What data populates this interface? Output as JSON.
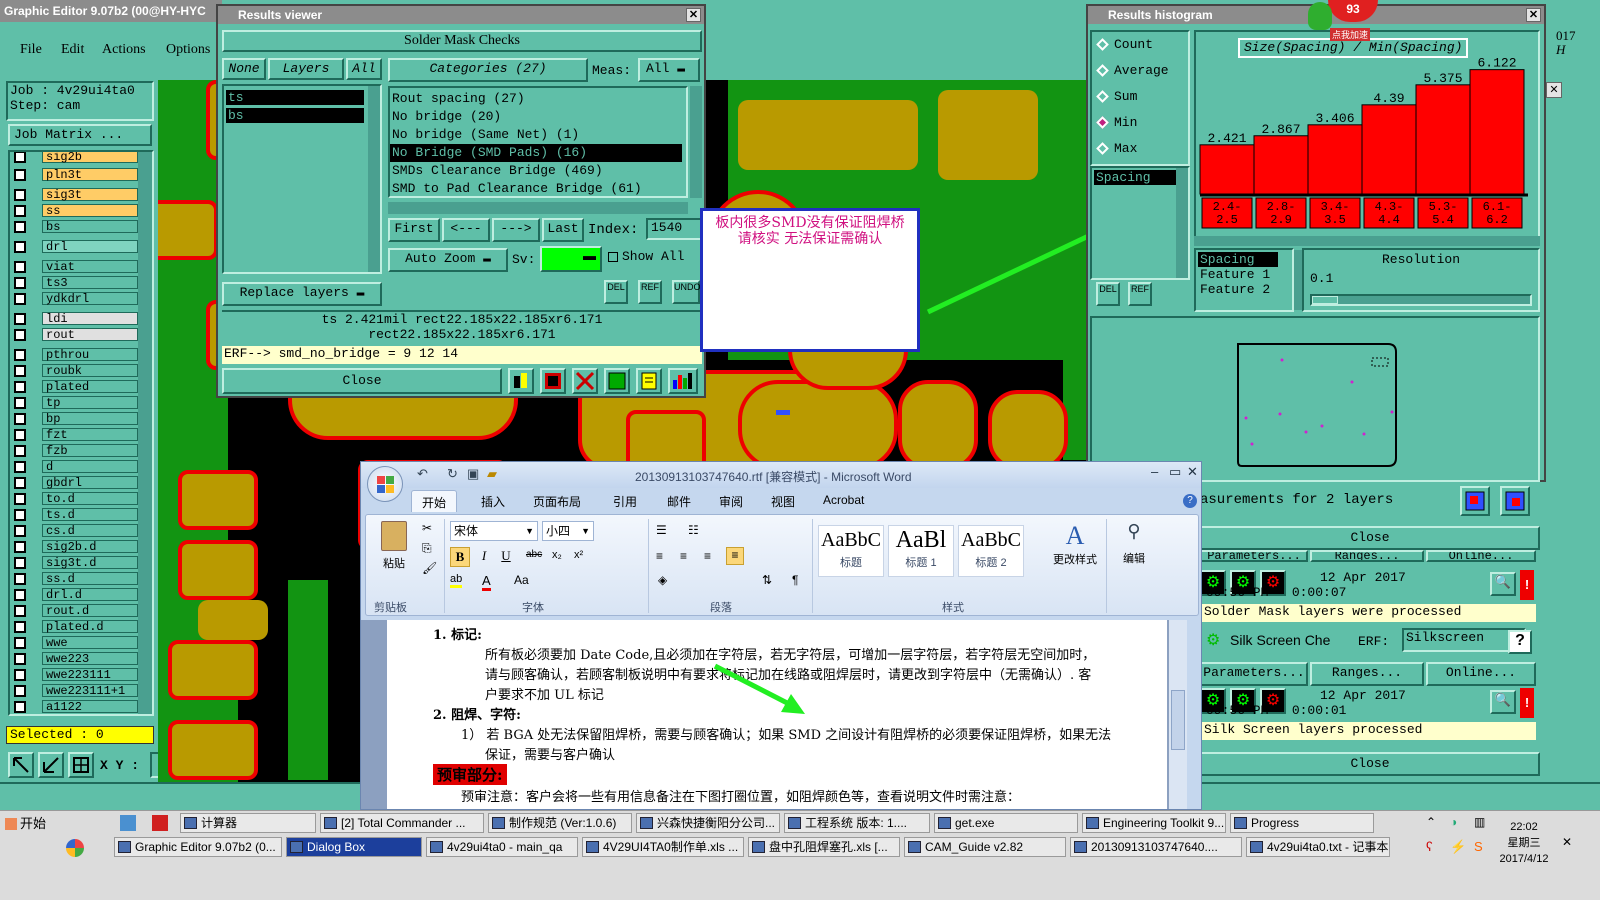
{
  "graphic_editor": {
    "title": "Graphic Editor 9.07b2 (00@HY-HYC",
    "menu": [
      "File",
      "Edit",
      "Actions",
      "Options"
    ],
    "job_label": "Job : 4v29ui4ta0",
    "step_label": "Step: cam",
    "job_matrix_button": "Job Matrix ...",
    "layers": [
      "sig2b",
      "pln3t",
      "sig3t",
      "ss",
      "bs",
      "drl",
      "viat",
      "ts3",
      "ydkdrl",
      "ldi",
      "rout",
      "pthrou",
      "roubk",
      "plated",
      "tp",
      "bp",
      "fzt",
      "fzb",
      "d",
      "gbdrl",
      "to.d",
      "ts.d",
      "cs.d",
      "sig2b.d",
      "sig3t.d",
      "ss.d",
      "drl.d",
      "rout.d",
      "plated.d",
      "wwe",
      "wwe223",
      "wwe223111",
      "wwe223111+1",
      "a1122"
    ],
    "selected_label": "Selected : 0",
    "xy_label": "X Y :",
    "right_edge_labels": [
      "017",
      "H"
    ],
    "colors": {
      "canvas_bg": "#000000",
      "copper": "#b99a00",
      "mask_edge": "#ee0000",
      "green": "#129412",
      "teal": "#5fbfa8"
    }
  },
  "results_viewer": {
    "title": "Results viewer",
    "header": "Solder Mask Checks",
    "none_btn": "None",
    "layers_btn": "Layers",
    "all_btn": "All",
    "layer_list": [
      "ts",
      "bs"
    ],
    "categories_label": "Categories (27)",
    "meas_label": "Meas:",
    "meas_value": "All",
    "categories": [
      "Rout spacing (27)",
      "No bridge (20)",
      "No bridge (Same Net) (1)",
      "No Bridge (SMD Pads) (16)",
      "SMDs Clearance Bridge (469)",
      "SMD to Pad Clearance Bridge (61)"
    ],
    "selected_category": 3,
    "nav": {
      "first": "First",
      "prev": "<---",
      "next": "--->",
      "last": "Last",
      "index_label": "Index:",
      "index_value": "1540"
    },
    "auto_zoom": "Auto Zoom",
    "sv_label": "Sv:",
    "show_all": "Show All",
    "replace_layers": "Replace layers",
    "icon_labels": [
      "DEL",
      "REF",
      "UNDO"
    ],
    "info_line1": "ts 2.421mil  rect22.185x22.185xr6.171",
    "info_line2": "rect22.185x22.185xr6.171",
    "erf_line": "ERF--> smd_no_bridge = 9 12 14",
    "close": "Close"
  },
  "annotation_box": {
    "text": "板内很多SMD没有保证阻焊桥  请核实  无法保证需确认"
  },
  "results_histogram": {
    "title": "Results histogram",
    "options": [
      "Count",
      "Average",
      "Sum",
      "Min",
      "Max"
    ],
    "selected_option": "Min",
    "spacing_label": "Spacing",
    "chart_title": "Size(Spacing) / Min(Spacing)",
    "resolution_label": "Resolution",
    "resolution_value": "0.1",
    "feature_list": [
      "Spacing",
      "Feature 1",
      "Feature 2"
    ],
    "icon_labels": [
      "DEL",
      "REF"
    ],
    "badge": "93",
    "badge_caption": "点我加速"
  },
  "chart_data": {
    "type": "bar",
    "title": "Size(Spacing) / Min(Spacing)",
    "categories": [
      "2.4-2.5",
      "2.8-2.9",
      "3.4-3.5",
      "4.3-4.4",
      "5.3-5.4",
      "6.1-6.2"
    ],
    "values": [
      2.421,
      2.867,
      3.406,
      4.39,
      5.375,
      6.122
    ],
    "value_labels": [
      "2.421",
      "2.867",
      "3.406",
      "4.39",
      "5.375",
      "6.122"
    ],
    "bin_labels": [
      [
        "2.4-",
        "2.5"
      ],
      [
        "2.8-",
        "2.9"
      ],
      [
        "3.4-",
        "3.5"
      ],
      [
        "4.3-",
        "4.4"
      ],
      [
        "5.3-",
        "5.4"
      ],
      [
        "6.1-",
        "6.2"
      ]
    ],
    "ylim": [
      0,
      6.4
    ],
    "color": "#ff0000",
    "grid": false
  },
  "check_panel": {
    "measurements_text": "asurements for 2 layers",
    "close": "Close",
    "row1_cols": [
      "Parameters...",
      "Ranges...",
      "Online..."
    ],
    "run1_date": "12 Apr 2017",
    "run1_time": "09:56 PM - 0:00:07",
    "run1_status": "Solder Mask layers were processed",
    "silk_label": "Silk Screen Che",
    "erf_label": "ERF:",
    "erf_value": "Silkscreen",
    "row2_cols": [
      "Parameters...",
      "Ranges...",
      "Online..."
    ],
    "run2_date": "12 Apr 2017",
    "run2_time": "09:56 PM - 0:00:01",
    "run2_status": "Silk Screen layers processed",
    "close2": "Close"
  },
  "word": {
    "title": "20130913103747640.rtf [兼容模式] - Microsoft Word",
    "tabs": [
      "开始",
      "插入",
      "页面布局",
      "引用",
      "邮件",
      "审阅",
      "视图",
      "Acrobat"
    ],
    "font_name": "宋体",
    "font_size": "小四",
    "group_labels": [
      "剪贴板",
      "字体",
      "段落",
      "样式",
      "编辑"
    ],
    "paste": "粘贴",
    "styles": [
      {
        "sample": "AaBbC",
        "name": "标题"
      },
      {
        "sample": "AaBl",
        "name": "标题 1"
      },
      {
        "sample": "AaBbC",
        "name": "标题 2"
      }
    ],
    "change_styles": "更改样式",
    "doc": {
      "h1": "1.   标记:",
      "p1": "所有板必须要加 Date Code,且必须加在字符层，若无字符层，可增加一层字符层，若字符层无空间加时，",
      "p2": "请与顾客确认，若顾客制板说明中有要求将标记加在线路或阻焊层时，请更改到字符层中（无需确认）. 客",
      "p3": "户要求不加 UL 标记",
      "h2": "2.   阻焊、字符:",
      "p4": "1） 若 BGA 处无法保留阻焊桥，需要与顾客确认；如果 SMD 之间设计有阻焊桥的必须要保证阻焊桥，如果无法",
      "p5": "保证，需要与客户确认",
      "h3": "预审部分:",
      "p6": "预审注意：客户会将一些有用信息备注在下图打圈位置，如阻焊颜色等，查看说明文件时需注意："
    }
  },
  "taskbar": {
    "start": "开始",
    "row1": [
      "计算器",
      "[2] Total Commander ...",
      "制作规范 (Ver:1.0.6)",
      "兴森快捷衡阳分公司...",
      "工程系统  版本: 1....",
      "get.exe",
      "Engineering Toolkit 9....",
      "Progress"
    ],
    "row2": [
      "Graphic Editor 9.07b2 (0...",
      "Dialog Box",
      "4v29ui4ta0 - main_qa",
      "4V29UI4TA0制作单.xls ...",
      "盘中孔阻焊塞孔.xls [...",
      "CAM_Guide v2.82",
      "20130913103747640....",
      "4v29ui4ta0.txt - 记事本"
    ],
    "active_index_row2": 1,
    "clock_time": "22:02",
    "clock_day": "星期三",
    "clock_date": "2017/4/12"
  }
}
